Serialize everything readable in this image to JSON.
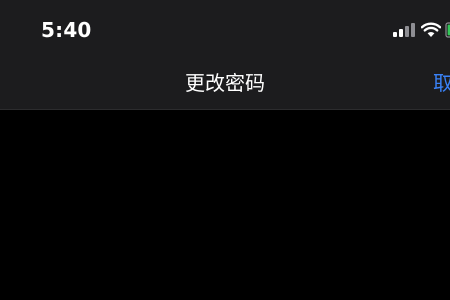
{
  "status_bar": {
    "time": "5:40",
    "icons": [
      "cellular-signal-icon",
      "wifi-icon",
      "battery-icon"
    ]
  },
  "nav": {
    "title": "更改密码",
    "cancel_label": "取消"
  },
  "colors": {
    "background": "#000000",
    "header": "#1c1c1e",
    "accent": "#3a82f7",
    "battery": "#34c759",
    "text": "#ffffff"
  }
}
